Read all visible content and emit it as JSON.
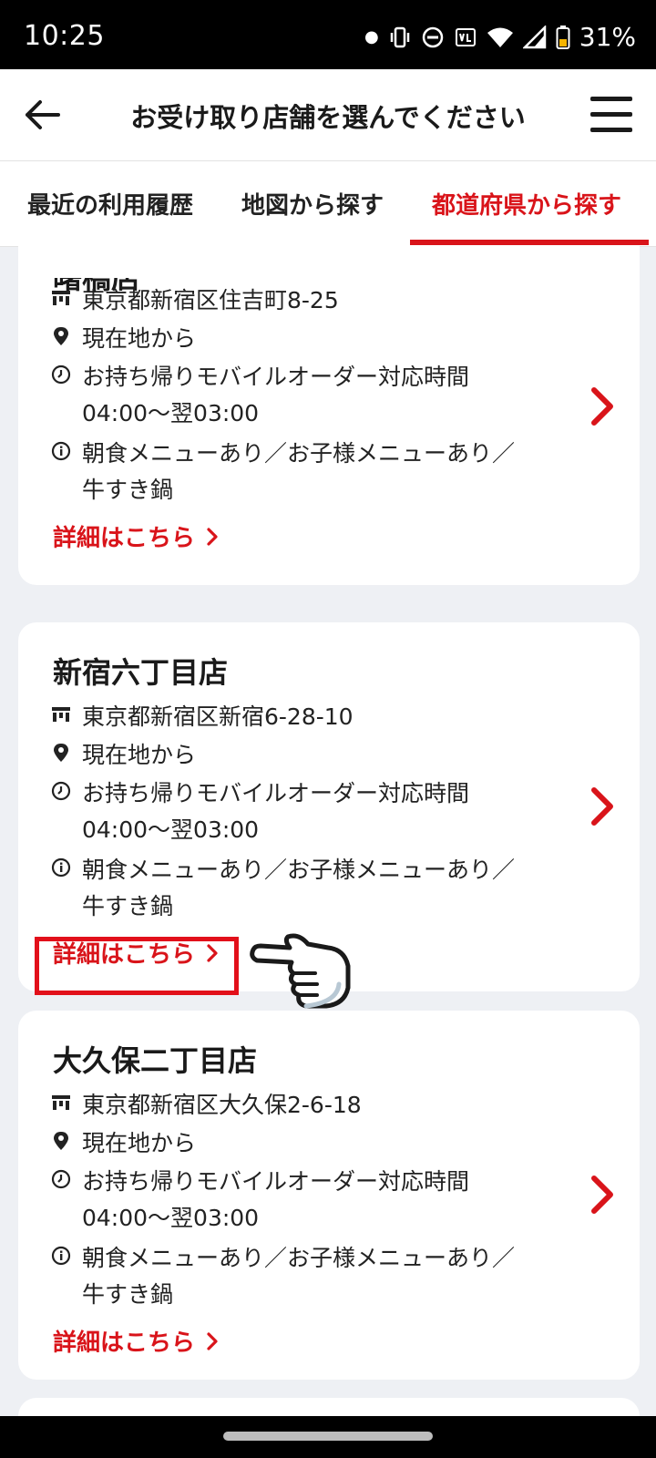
{
  "status": {
    "time": "10:25",
    "battery": "31%"
  },
  "header": {
    "title": "お受け取り店舗を選んでください"
  },
  "tabs": [
    {
      "label": "最近の利用履歴"
    },
    {
      "label": "地図から探す"
    },
    {
      "label": "都道府県から探す",
      "active": true
    }
  ],
  "stores": [
    {
      "name": "曙橋店",
      "address": "東京都新宿区住吉町8-25",
      "distance": "現在地から",
      "hours_label": "お持ち帰りモバイルオーダー対応時間",
      "hours": "04:00〜翌03:00",
      "info_line1": "朝食メニューあり／お子様メニューあり／",
      "info_line2": "牛すき鍋",
      "detail_label": "詳細はこちら"
    },
    {
      "name": "新宿六丁目店",
      "address": "東京都新宿区新宿6-28-10",
      "distance": "現在地から",
      "hours_label": "お持ち帰りモバイルオーダー対応時間",
      "hours": "04:00〜翌03:00",
      "info_line1": "朝食メニューあり／お子様メニューあり／",
      "info_line2": "牛すき鍋",
      "detail_label": "詳細はこちら"
    },
    {
      "name": "大久保二丁目店",
      "address": "東京都新宿区大久保2-6-18",
      "distance": "現在地から",
      "hours_label": "お持ち帰りモバイルオーダー対応時間",
      "hours": "04:00〜翌03:00",
      "info_line1": "朝食メニューあり／お子様メニューあり／",
      "info_line2": "牛すき鍋",
      "detail_label": "詳細はこちら"
    }
  ],
  "colors": {
    "accent": "#d9141a",
    "highlight_box": "#e2101a"
  }
}
